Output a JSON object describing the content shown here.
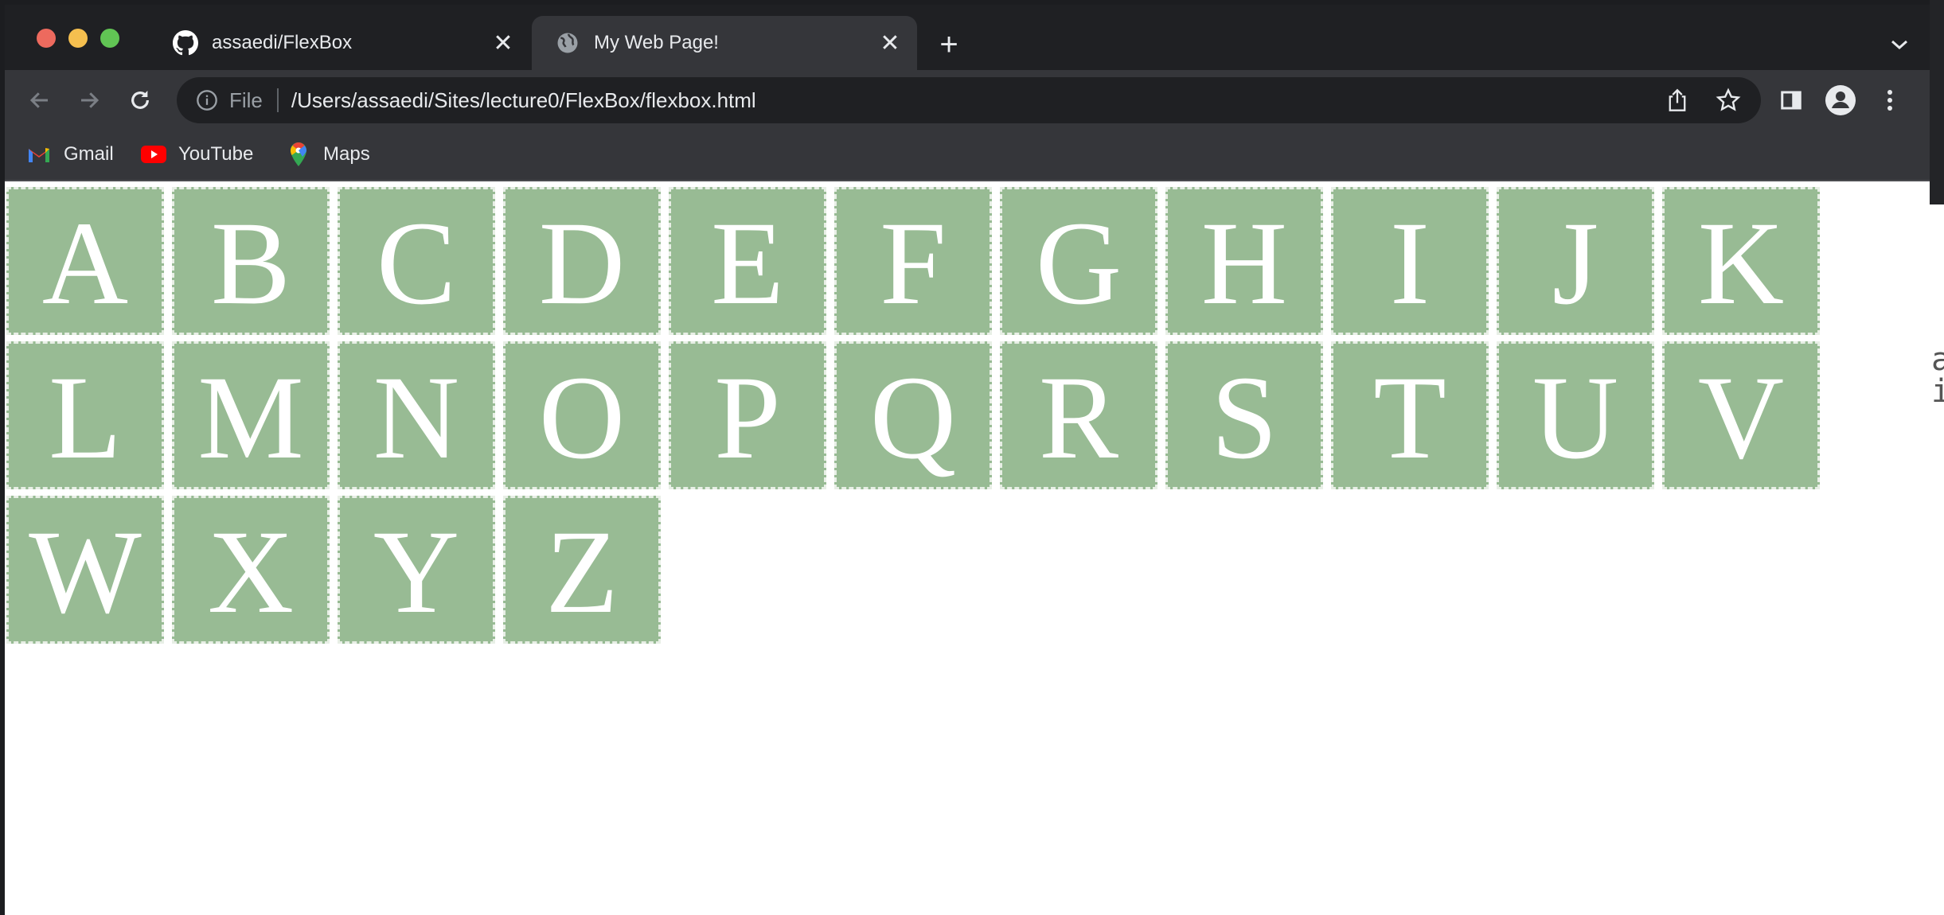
{
  "browser": {
    "tabs": [
      {
        "title": "assaedi/FlexBox",
        "icon": "github-icon",
        "active": false
      },
      {
        "title": "My Web Page!",
        "icon": "globe-icon",
        "active": true
      }
    ],
    "address": {
      "scheme_label": "File",
      "url": "/Users/assaedi/Sites/lecture0/FlexBox/flexbox.html"
    },
    "bookmarks": [
      {
        "label": "Gmail",
        "icon": "gmail-icon"
      },
      {
        "label": "YouTube",
        "icon": "youtube-icon"
      },
      {
        "label": "Maps",
        "icon": "maps-icon"
      }
    ]
  },
  "page": {
    "letters": [
      "A",
      "B",
      "C",
      "D",
      "E",
      "F",
      "G",
      "H",
      "I",
      "J",
      "K",
      "L",
      "M",
      "N",
      "O",
      "P",
      "Q",
      "R",
      "S",
      "T",
      "U",
      "V",
      "W",
      "X",
      "Y",
      "Z"
    ],
    "colors": {
      "box_background": "#98bb94",
      "box_border": "#e8efe6",
      "letter_color": "#ffffff"
    }
  },
  "background_peek_text": "a\ni"
}
